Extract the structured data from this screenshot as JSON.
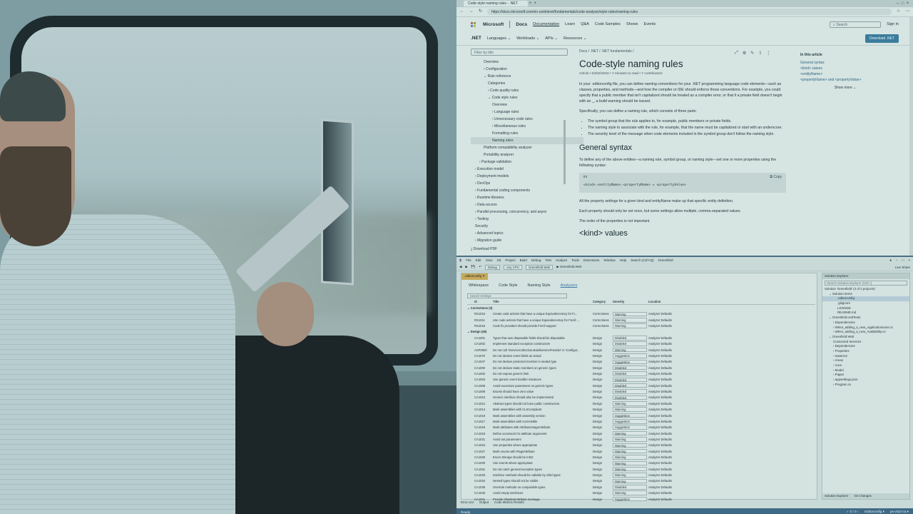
{
  "browser": {
    "tab_title": "Code-style naming rules - .NET",
    "url": "https://docs.microsoft.com/en-us/dotnet/fundamentals/code-analysis/style-rules/naming-rules",
    "header": {
      "brand": "Microsoft",
      "docs": "Docs",
      "nav": [
        "Documentation",
        "Learn",
        "Q&A",
        "Code Samples",
        "Shows",
        "Events"
      ],
      "search_placeholder": "Search",
      "sign_in": "Sign in"
    },
    "subnav": {
      "title": ".NET",
      "items": [
        "Languages",
        "Workloads",
        "APIs",
        "Resources"
      ],
      "download": "Download .NET"
    },
    "toc": {
      "filter_placeholder": "Filter by title",
      "items": [
        {
          "label": "Overview",
          "indent": 3,
          "selected": false
        },
        {
          "label": "› Configuration",
          "indent": 3,
          "selected": false
        },
        {
          "label": "⌄ Rule reference",
          "indent": 3,
          "selected": false
        },
        {
          "label": "Categories",
          "indent": 4,
          "selected": false
        },
        {
          "label": "› Code quality rules",
          "indent": 4,
          "selected": false
        },
        {
          "label": "⌄ Code style rules",
          "indent": 4,
          "selected": false
        },
        {
          "label": "Overview",
          "indent": 5,
          "selected": false
        },
        {
          "label": "› Language rules",
          "indent": 5,
          "selected": false
        },
        {
          "label": "› Unnecessary code rules",
          "indent": 5,
          "selected": false
        },
        {
          "label": "› Miscellaneous rules",
          "indent": 5,
          "selected": false
        },
        {
          "label": "Formatting rules",
          "indent": 5,
          "selected": false
        },
        {
          "label": "Naming rules",
          "indent": 5,
          "selected": true
        },
        {
          "label": "Platform compatibility analyzer",
          "indent": 3,
          "selected": false
        },
        {
          "label": "Portability analyzer",
          "indent": 3,
          "selected": false
        },
        {
          "label": "› Package validation",
          "indent": 2,
          "selected": false
        },
        {
          "label": "› Execution model",
          "indent": 1,
          "selected": false
        },
        {
          "label": "› Deployment models",
          "indent": 1,
          "selected": false
        },
        {
          "label": "› DevOps",
          "indent": 1,
          "selected": false
        },
        {
          "label": "› Fundamental coding components",
          "indent": 1,
          "selected": false
        },
        {
          "label": "› Runtime libraries",
          "indent": 1,
          "selected": false
        },
        {
          "label": "› Data access",
          "indent": 1,
          "selected": false
        },
        {
          "label": "› Parallel processing, concurrency, and async",
          "indent": 1,
          "selected": false
        },
        {
          "label": "› Testing",
          "indent": 1,
          "selected": false
        },
        {
          "label": "Security",
          "indent": 1,
          "selected": false
        },
        {
          "label": "› Advanced topics",
          "indent": 1,
          "selected": false
        },
        {
          "label": "› Migration guide",
          "indent": 1,
          "selected": false
        }
      ],
      "download_pdf": "Download PDF"
    },
    "article": {
      "breadcrumb": "Docs / .NET / .NET fundamentals /",
      "title": "Code-style naming rules",
      "meta": "Article • 04/02/2022 • 7 minutes to read • 7 contributors",
      "intro": "In your .editorconfig file, you can define naming conventions for your .NET programming language code elements—such as classes, properties, and methods—and how the compiler or IDE should enforce those conventions. For example, you could specify that a public member that isn't capitalized should be treated as a compiler error, or that if a private field doesn't begin with an _, a build warning should be issued.",
      "specifically": "Specifically, you can define a naming rule, which consists of three parts:",
      "bullets": [
        "The symbol group that the rule applies to, for example, public members or private fields.",
        "The naming style to associate with the rule, for example, that the name must be capitalized or start with an underscore.",
        "The severity level of the message when code elements included in the symbol group don't follow the naming style."
      ],
      "h2_general": "General syntax",
      "general_p": "To define any of the above entities—a naming rule, symbol group, or naming style—set one or more properties using the following syntax:",
      "code_lang": "ini",
      "copy_label": "Copy",
      "code": "<kind>.<entityName>.<propertyName> = <propertyValue>",
      "p_settings": "All the property settings for a given kind and entityName make up that specific entity definition.",
      "p_once": "Each property should only be set once, but some settings allow multiple, comma-separated values.",
      "p_order": "The order of the properties is not important.",
      "h2_kind": "<kind> values"
    },
    "in_this_article": {
      "heading": "In this article",
      "links": [
        "General syntax",
        "<kind> values",
        "<entityName>",
        "<propertyName> and <propertyValue>"
      ],
      "show_more": "Show more ⌄"
    }
  },
  "vs": {
    "menu": [
      "File",
      "Edit",
      "View",
      "Git",
      "Project",
      "Build",
      "Debug",
      "Test",
      "Analyze",
      "Tools",
      "Extensions",
      "Window",
      "Help"
    ],
    "search_label": "Search (Ctrl+Q)",
    "solution_name": "Greenfield",
    "toolbar": {
      "config": "Debug",
      "platform": "Any CPU",
      "project": "Greenfield.Web",
      "run": "▶ Greenfield.Web"
    },
    "live_share": "Live Share",
    "doc_tab": ".editorconfig ✕",
    "config_tabs": [
      "Whitespace",
      "Code Style",
      "Naming Style",
      "Analyzers"
    ],
    "settings_search": "Search Settings",
    "columns": [
      "Id",
      "Title",
      "Category",
      "Severity",
      "Location"
    ],
    "rows": [
      {
        "group": "⌄ Correctness (3)"
      },
      {
        "id": "RS1015",
        "title": "Create code actions that have a unique EquivalenceKey for Fi...",
        "cat": "Correctness",
        "sev": "Warning",
        "loc": "Analyzer Defaults"
      },
      {
        "id": "RS1011",
        "title": "Use code actions that have a unique EquivalenceKey for FixAll ...",
        "cat": "Correctness",
        "sev": "Warning",
        "loc": "Analyzer Defaults"
      },
      {
        "id": "RS1016",
        "title": "Code fix providers should provide FixAll support",
        "cat": "Correctness",
        "sev": "Warning",
        "loc": "Analyzer Defaults"
      },
      {
        "group": "⌄ Design (49)"
      },
      {
        "id": "CA1001",
        "title": "Types that own disposable fields should be disposable",
        "cat": "Design",
        "sev": "Disabled",
        "loc": "Analyzer Defaults"
      },
      {
        "id": "CA1002",
        "title": "Implement standard exception constructors",
        "cat": "Design",
        "sev": "Disabled",
        "loc": "Analyzer Defaults"
      },
      {
        "id": "ASP0000",
        "title": "Do not call 'IServiceCollection.BuildServiceProvider' in 'Configur...",
        "cat": "Design",
        "sev": "Warning",
        "loc": "Analyzer Defaults"
      },
      {
        "id": "CA1070",
        "title": "Do not declare event fields as virtual",
        "cat": "Design",
        "sev": "Suggestion",
        "loc": "Analyzer Defaults"
      },
      {
        "id": "CA1047",
        "title": "Do not declare protected member in sealed type",
        "cat": "Design",
        "sev": "Suggestion",
        "loc": "Analyzer Defaults"
      },
      {
        "id": "CA1000",
        "title": "Do not declare static members on generic types",
        "cat": "Design",
        "sev": "Disabled",
        "loc": "Analyzer Defaults"
      },
      {
        "id": "CA1002",
        "title": "Do not expose generic lists",
        "cat": "Design",
        "sev": "Disabled",
        "loc": "Analyzer Defaults"
      },
      {
        "id": "CA1003",
        "title": "Use generic event handler instances",
        "cat": "Design",
        "sev": "Disabled",
        "loc": "Analyzer Defaults"
      },
      {
        "id": "CA1005",
        "title": "Avoid excessive parameters on generic types",
        "cat": "Design",
        "sev": "Disabled",
        "loc": "Analyzer Defaults"
      },
      {
        "id": "CA1008",
        "title": "Enums should have zero value",
        "cat": "Design",
        "sev": "Disabled",
        "loc": "Analyzer Defaults"
      },
      {
        "id": "CA1010",
        "title": "Generic interface should also be implemented",
        "cat": "Design",
        "sev": "Disabled",
        "loc": "Analyzer Defaults"
      },
      {
        "id": "CA1012",
        "title": "Abstract types should not have public constructors",
        "cat": "Design",
        "sev": "Warning",
        "loc": "Analyzer Defaults"
      },
      {
        "id": "CA1014",
        "title": "Mark assemblies with CLSCompliant",
        "cat": "Design",
        "sev": "Warning",
        "loc": "Analyzer Defaults"
      },
      {
        "id": "CA1016",
        "title": "Mark assemblies with assembly version",
        "cat": "Design",
        "sev": "Suggestion",
        "loc": "Analyzer Defaults"
      },
      {
        "id": "CA1017",
        "title": "Mark assemblies with ComVisible",
        "cat": "Design",
        "sev": "Suggestion",
        "loc": "Analyzer Defaults"
      },
      {
        "id": "CA1018",
        "title": "Mark attributes with AttributeUsageAttribute",
        "cat": "Design",
        "sev": "Suggestion",
        "loc": "Analyzer Defaults"
      },
      {
        "id": "CA1019",
        "title": "Define accessors for attribute arguments",
        "cat": "Design",
        "sev": "Warning",
        "loc": "Analyzer Defaults"
      },
      {
        "id": "CA1021",
        "title": "Avoid out parameters",
        "cat": "Design",
        "sev": "Warning",
        "loc": "Analyzer Defaults"
      },
      {
        "id": "CA1024",
        "title": "Use properties where appropriate",
        "cat": "Design",
        "sev": "Warning",
        "loc": "Analyzer Defaults"
      },
      {
        "id": "CA1027",
        "title": "Mark enums with FlagsAttribute",
        "cat": "Design",
        "sev": "Warning",
        "loc": "Analyzer Defaults"
      },
      {
        "id": "CA1028",
        "title": "Enum Storage should be Int32",
        "cat": "Design",
        "sev": "Warning",
        "loc": "Analyzer Defaults"
      },
      {
        "id": "CA1030",
        "title": "Use events where appropriate",
        "cat": "Design",
        "sev": "Warning",
        "loc": "Analyzer Defaults"
      },
      {
        "id": "CA1031",
        "title": "Do not catch general exception types",
        "cat": "Design",
        "sev": "Warning",
        "loc": "Analyzer Defaults"
      },
      {
        "id": "CA1033",
        "title": "Interface methods should be callable by child types",
        "cat": "Design",
        "sev": "Warning",
        "loc": "Analyzer Defaults"
      },
      {
        "id": "CA1034",
        "title": "Nested types should not be visible",
        "cat": "Design",
        "sev": "Warning",
        "loc": "Analyzer Defaults"
      },
      {
        "id": "CA1036",
        "title": "Override methods on comparable types",
        "cat": "Design",
        "sev": "Disabled",
        "loc": "Analyzer Defaults"
      },
      {
        "id": "CA1040",
        "title": "Avoid empty interfaces",
        "cat": "Design",
        "sev": "Warning",
        "loc": "Analyzer Defaults"
      },
      {
        "id": "CA1041",
        "title": "Provide ObsoleteAttribute message",
        "cat": "Design",
        "sev": "Suggestion",
        "loc": "Analyzer Defaults"
      }
    ],
    "bottom_tabs": [
      "Error List",
      "Output",
      "Code Metrics Results"
    ],
    "status": {
      "left": "Ready",
      "mid": "✓ 0 / 0 ↑",
      "branch": "Editorconfig ▾",
      "repo": "ps-vs22-ca ▾"
    },
    "solution_explorer": {
      "title": "Solution Explorer",
      "search_placeholder": "Search Solution Explorer (Ctrl+;)",
      "nodes": [
        {
          "label": "Solution 'Greenfield' (2 of 2 projects)",
          "indent": 0,
          "sel": false
        },
        {
          "label": "⌄ Solution Items",
          "indent": 1,
          "sel": false
        },
        {
          "label": ".editorconfig",
          "indent": 3,
          "sel": true
        },
        {
          "label": ".gitignore",
          "indent": 3,
          "sel": false
        },
        {
          "label": "LICENSE",
          "indent": 3,
          "sel": false
        },
        {
          "label": "README.md",
          "indent": 3,
          "sel": false
        },
        {
          "label": "⌄ Greenfield.UnitTests",
          "indent": 1,
          "sel": false
        },
        {
          "label": "› Dependencies",
          "indent": 2,
          "sel": false
        },
        {
          "label": "› When_adding_a_new_ApplicationUser.cs",
          "indent": 2,
          "sel": false
        },
        {
          "label": "› When_adding_a_new_Availability.cs",
          "indent": 2,
          "sel": false
        },
        {
          "label": "⌄ Greenfield.Web",
          "indent": 1,
          "sel": false
        },
        {
          "label": "Connected Services",
          "indent": 2,
          "sel": false
        },
        {
          "label": "› Dependencies",
          "indent": 2,
          "sel": false
        },
        {
          "label": "› Properties",
          "indent": 2,
          "sel": false
        },
        {
          "label": "› wwwroot",
          "indent": 2,
          "sel": false
        },
        {
          "label": "› Areas",
          "indent": 2,
          "sel": false
        },
        {
          "label": "› Core",
          "indent": 2,
          "sel": false
        },
        {
          "label": "› Model",
          "indent": 2,
          "sel": false
        },
        {
          "label": "› Pages",
          "indent": 2,
          "sel": false
        },
        {
          "label": "› appsettings.json",
          "indent": 2,
          "sel": false
        },
        {
          "label": "› Program.cs",
          "indent": 2,
          "sel": false
        }
      ],
      "footer": [
        "Solution Explorer",
        "Git Changes"
      ]
    }
  }
}
